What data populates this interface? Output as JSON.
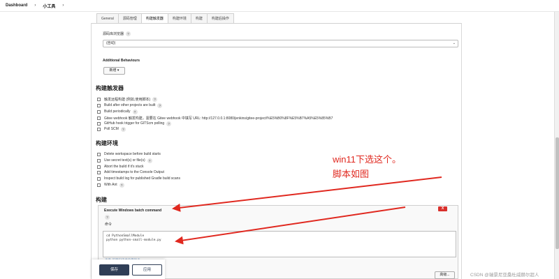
{
  "breadcrumb": {
    "dashboard": "Dashboard",
    "sep1": "›",
    "project": "小工具",
    "sep2": "›"
  },
  "tabs": [
    {
      "label": "General",
      "active": false
    },
    {
      "label": "源码管理",
      "active": false
    },
    {
      "label": "构建触发器",
      "active": true
    },
    {
      "label": "构建环境",
      "active": false
    },
    {
      "label": "构建",
      "active": false
    },
    {
      "label": "构建后操作",
      "active": false
    }
  ],
  "scm": {
    "browser_label": "源码库浏览器",
    "browser_value": "(自动)",
    "additional_behaviours": "Additional Behaviours",
    "add_button": "新增 ▾"
  },
  "triggers": {
    "title": "构建触发器",
    "items": [
      {
        "label": "触发远程构建 (例如,使用脚本)",
        "help": true
      },
      {
        "label": "Build after other projects are built",
        "help": true
      },
      {
        "label": "Build periodically",
        "help": true
      },
      {
        "label": "Gitee webhook 触发构建，需要在 Gitee webhook 中填写 URL: http://127.0.0.1:8080/jenkins/gitee-project/%E5%B0%8F%E5%B7%A5%E5%85%B7",
        "help": false
      },
      {
        "label": "GitHub hook trigger for GITScm polling",
        "help": true
      },
      {
        "label": "Poll SCM",
        "help": true
      }
    ]
  },
  "environment": {
    "title": "构建环境",
    "items": [
      {
        "label": "Delete workspace before build starts",
        "help": false
      },
      {
        "label": "Use secret text(s) or file(s)",
        "help": true
      },
      {
        "label": "Abort the build if it's stuck",
        "help": false
      },
      {
        "label": "Add timestamps to the Console Output",
        "help": false
      },
      {
        "label": "Inspect build log for published Gradle build scans",
        "help": false
      },
      {
        "label": "With Ant",
        "help": true
      }
    ]
  },
  "build": {
    "title": "构建",
    "step_title": "Execute Windows batch command",
    "delete_label": "X",
    "command_label": "命令",
    "command_lines": [
      "cd PythonSmallModule",
      "python python-small-module.py"
    ],
    "env_link": "查看 可用的环境变量列表",
    "advanced_label": "高级..."
  },
  "actions": {
    "save": "保存",
    "apply": "应用"
  },
  "help_glyph": "?",
  "annotation": {
    "line1": "win11下选这个。",
    "line2": "脚本如图",
    "color": "#e0281f"
  },
  "watermark": "CSDN @瑞景尼亚桑杜威赫尔超人"
}
